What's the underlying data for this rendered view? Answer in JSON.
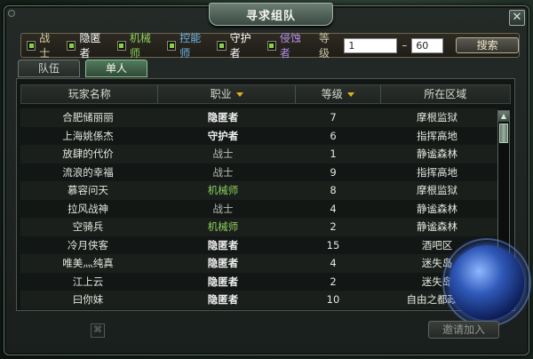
{
  "window": {
    "title": "寻求组队",
    "close_glyph": "✕"
  },
  "filters": [
    {
      "label": "战士",
      "checked": true,
      "color": "#d8cfa0"
    },
    {
      "label": "隐匿者",
      "checked": true,
      "color": "#ffffff"
    },
    {
      "label": "机械师",
      "checked": true,
      "color": "#8ccf5e"
    },
    {
      "label": "控能师",
      "checked": true,
      "color": "#6fb7e8"
    },
    {
      "label": "守护者",
      "checked": true,
      "color": "#ffffff"
    },
    {
      "label": "侵蚀者",
      "checked": true,
      "color": "#b58ee6"
    }
  ],
  "level": {
    "label": "等级",
    "min": "1",
    "separator": "–",
    "max": "60"
  },
  "search_button": "搜索",
  "tabs": {
    "team": "队伍",
    "single": "单人"
  },
  "table": {
    "headers": {
      "name": "玩家名称",
      "job": "职业",
      "level": "等级",
      "zone": "所在区域"
    },
    "rows": [
      {
        "name": "合肥储丽丽",
        "job": "隐匿者",
        "job_style": "bold",
        "level": "7",
        "zone": "摩根监狱"
      },
      {
        "name": "上海姚係杰",
        "job": "守护者",
        "job_style": "bold",
        "level": "6",
        "zone": "指挥高地"
      },
      {
        "name": "放肆的代价",
        "job": "战士",
        "job_style": "gray",
        "level": "1",
        "zone": "静谧森林"
      },
      {
        "name": "流浪的幸福",
        "job": "战士",
        "job_style": "gray",
        "level": "9",
        "zone": "指挥高地"
      },
      {
        "name": "慕容问天",
        "job": "机械师",
        "job_style": "green",
        "level": "8",
        "zone": "摩根监狱"
      },
      {
        "name": "拉风战神",
        "job": "战士",
        "job_style": "gray",
        "level": "4",
        "zone": "静谧森林"
      },
      {
        "name": "空骑兵",
        "job": "机械师",
        "job_style": "green",
        "level": "2",
        "zone": "静谧森林"
      },
      {
        "name": "冷月侠客",
        "job": "隐匿者",
        "job_style": "bold",
        "level": "15",
        "zone": "酒吧区"
      },
      {
        "name": "唯美灬纯真",
        "job": "隐匿者",
        "job_style": "bold",
        "level": "4",
        "zone": "迷失岛"
      },
      {
        "name": "江上云",
        "job": "隐匿者",
        "job_style": "bold",
        "level": "2",
        "zone": "迷失岛"
      },
      {
        "name": "曰你妹",
        "job": "隐匿者",
        "job_style": "bold",
        "level": "10",
        "zone": "自由之都政府"
      }
    ]
  },
  "invite_button": "邀请加入",
  "colors": {
    "accent": "#8bd04a",
    "sort_arrow": "#e0b11e"
  }
}
